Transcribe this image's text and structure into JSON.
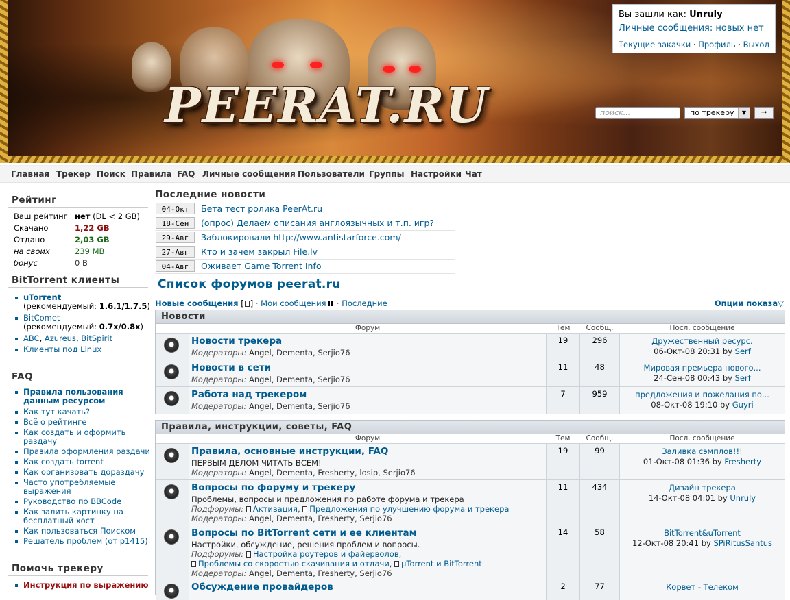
{
  "header": {
    "logo_text": "PEERAT.RU",
    "user": {
      "logged_as_label": "Вы зашли как:",
      "username": "Unruly",
      "pm_label": "Личные сообщения: новых нет",
      "links": [
        "Текущие закачки",
        "Профиль",
        "Выход"
      ],
      "link_sep": "·"
    },
    "search": {
      "placeholder": "поиск...",
      "scope": "по трекеру",
      "go_label": "→"
    }
  },
  "nav": [
    "Главная",
    "Трекер",
    "Поиск",
    "Правила",
    "FAQ",
    "Личные сообщения",
    "Пользователи",
    "Группы",
    "Настройки",
    "Чат"
  ],
  "sidebar": {
    "rating": {
      "title": "Рейтинг",
      "rows": [
        {
          "label": "Ваш рейтинг",
          "value": "нет",
          "extra": "(DL < 2 GB)"
        },
        {
          "label": "Скачано",
          "value": "1,22 GB",
          "color": "#8b1010"
        },
        {
          "label": "Отдано",
          "value": "2,03 GB",
          "color": "#1a6a1a"
        },
        {
          "label": "на своих",
          "value": "239 MB",
          "color": "#1a6a1a"
        },
        {
          "label": "бонус",
          "value": "0 B",
          "color": "#333"
        }
      ]
    },
    "clients": {
      "title": "BitTorrent клиенты",
      "utorrent": "uTorrent",
      "utorrent_rec_label": "(рекомендуемый:",
      "utorrent_rec_ver": "1.6.1/1.7.5",
      "bitcomet": "BitComet",
      "bitcomet_rec_label": "(рекомендуемый:",
      "bitcomet_rec_ver": "0.7x/0.8x",
      "others": [
        "ABC",
        "Azureus",
        "BitSpirit"
      ],
      "linux": "Клиенты под Linux"
    },
    "faq": {
      "title": "FAQ",
      "items": [
        "Правила пользования данным ресурсом",
        "Как тут качать?",
        "Всё о рейтинге",
        "Как создать и оформить раздачу",
        "Правила оформления раздачи",
        "Как создать torrent",
        "Как организовать дораздачу",
        "Часто употребляемые выражения",
        "Руководство по BBCode",
        "Как залить картинку на бесплатный хост",
        "Как пользоваться Поиском",
        "Решатель проблем (от p1415)"
      ]
    },
    "help": {
      "title": "Помочь трекеру",
      "items": [
        "Инструкция по выражению"
      ]
    }
  },
  "news": {
    "title": "Последние новости",
    "items": [
      {
        "date": "04-Окт",
        "title": "Бета тест ролика PeerAt.ru"
      },
      {
        "date": "18-Сен",
        "title": "(опрос) Делаем описания англоязычных и т.п. игр?"
      },
      {
        "date": "29-Авг",
        "title": "Заблокировали http://www.antistarforce.com/"
      },
      {
        "date": "27-Авг",
        "title": "Кто и зачем закрыл File.lv"
      },
      {
        "date": "04-Авг",
        "title": "Оживает Game Torrent Info"
      }
    ]
  },
  "forum_list": {
    "title": "Список форумов peerat.ru",
    "toolbar": {
      "new_posts": "Новые сообщения",
      "my_posts": "Мои сообщения",
      "latest": "Последние",
      "options": "Опции показа"
    },
    "columns": {
      "forum": "Форум",
      "topics": "Тем",
      "posts": "Сообщ.",
      "last": "Посл. сообщение"
    },
    "moderators_label": "Модераторы:",
    "subforums_label": "Подфорумы:",
    "by_label": "by",
    "categories": [
      {
        "title": "Новости",
        "forums": [
          {
            "name": "Новости трекера",
            "mods": "Angel, Dementa, Serjio76",
            "topics": "19",
            "posts": "296",
            "last_title": "Дружественный ресурс.",
            "last_date": "06-Окт-08 20:31",
            "last_user": "Serf"
          },
          {
            "name": "Новости в сети",
            "mods": "Angel, Dementa, Serjio76",
            "topics": "11",
            "posts": "48",
            "last_title": "Мировая премьера нового...",
            "last_date": "24-Сен-08 00:43",
            "last_user": "Serf"
          },
          {
            "name": "Работа над трекером",
            "mods": "Angel, Dementa, Serjio76",
            "topics": "7",
            "posts": "959",
            "last_title": "предложения и пожелания по...",
            "last_date": "08-Окт-08 19:10",
            "last_user": "Guyri"
          }
        ]
      },
      {
        "title": "Правила, инструкции, советы, FAQ",
        "forums": [
          {
            "name": "Правила, основные инструкции, FAQ",
            "desc": "ПЕРВЫМ ДЕЛОМ ЧИТАТЬ ВСЕМ!",
            "mods": "Angel, Dementa, Fresherty, losip, Serjio76",
            "topics": "19",
            "posts": "99",
            "last_title": "Заливка сэмплов!!!",
            "last_date": "01-Окт-08 01:36",
            "last_user": "Fresherty"
          },
          {
            "name": "Вопросы по форуму и трекеру",
            "desc": "Проблемы, вопросы и предложения по работе форума и трекера",
            "subs": [
              "Активация",
              "Предложения по улучшению форума и трекера"
            ],
            "mods": "Angel, Dementa, Fresherty, Serjio76",
            "topics": "11",
            "posts": "434",
            "last_title": "Дизайн трекера",
            "last_date": "14-Окт-08 04:01",
            "last_user": "Unruly"
          },
          {
            "name": "Вопросы по BitTorrent сети и ее клиентам",
            "desc": "Настройки, обсуждение, решения проблем и вопросы.",
            "subs": [
              "Настройка роутеров и файерволов",
              "Проблемы со скоростью скачивания и отдачи",
              "µTorrent и BitTorrent"
            ],
            "mods": "Angel, Dementa, Fresherty, Serjio76",
            "topics": "14",
            "posts": "58",
            "last_title": "BitTorrent&uTorrent",
            "last_date": "12-Окт-08 20:41",
            "last_user": "SPiRitusSantus"
          },
          {
            "name": "Обсуждение провайдеров",
            "topics": "2",
            "posts": "77",
            "last_title": "Корвет - Телеком"
          }
        ]
      }
    ]
  }
}
